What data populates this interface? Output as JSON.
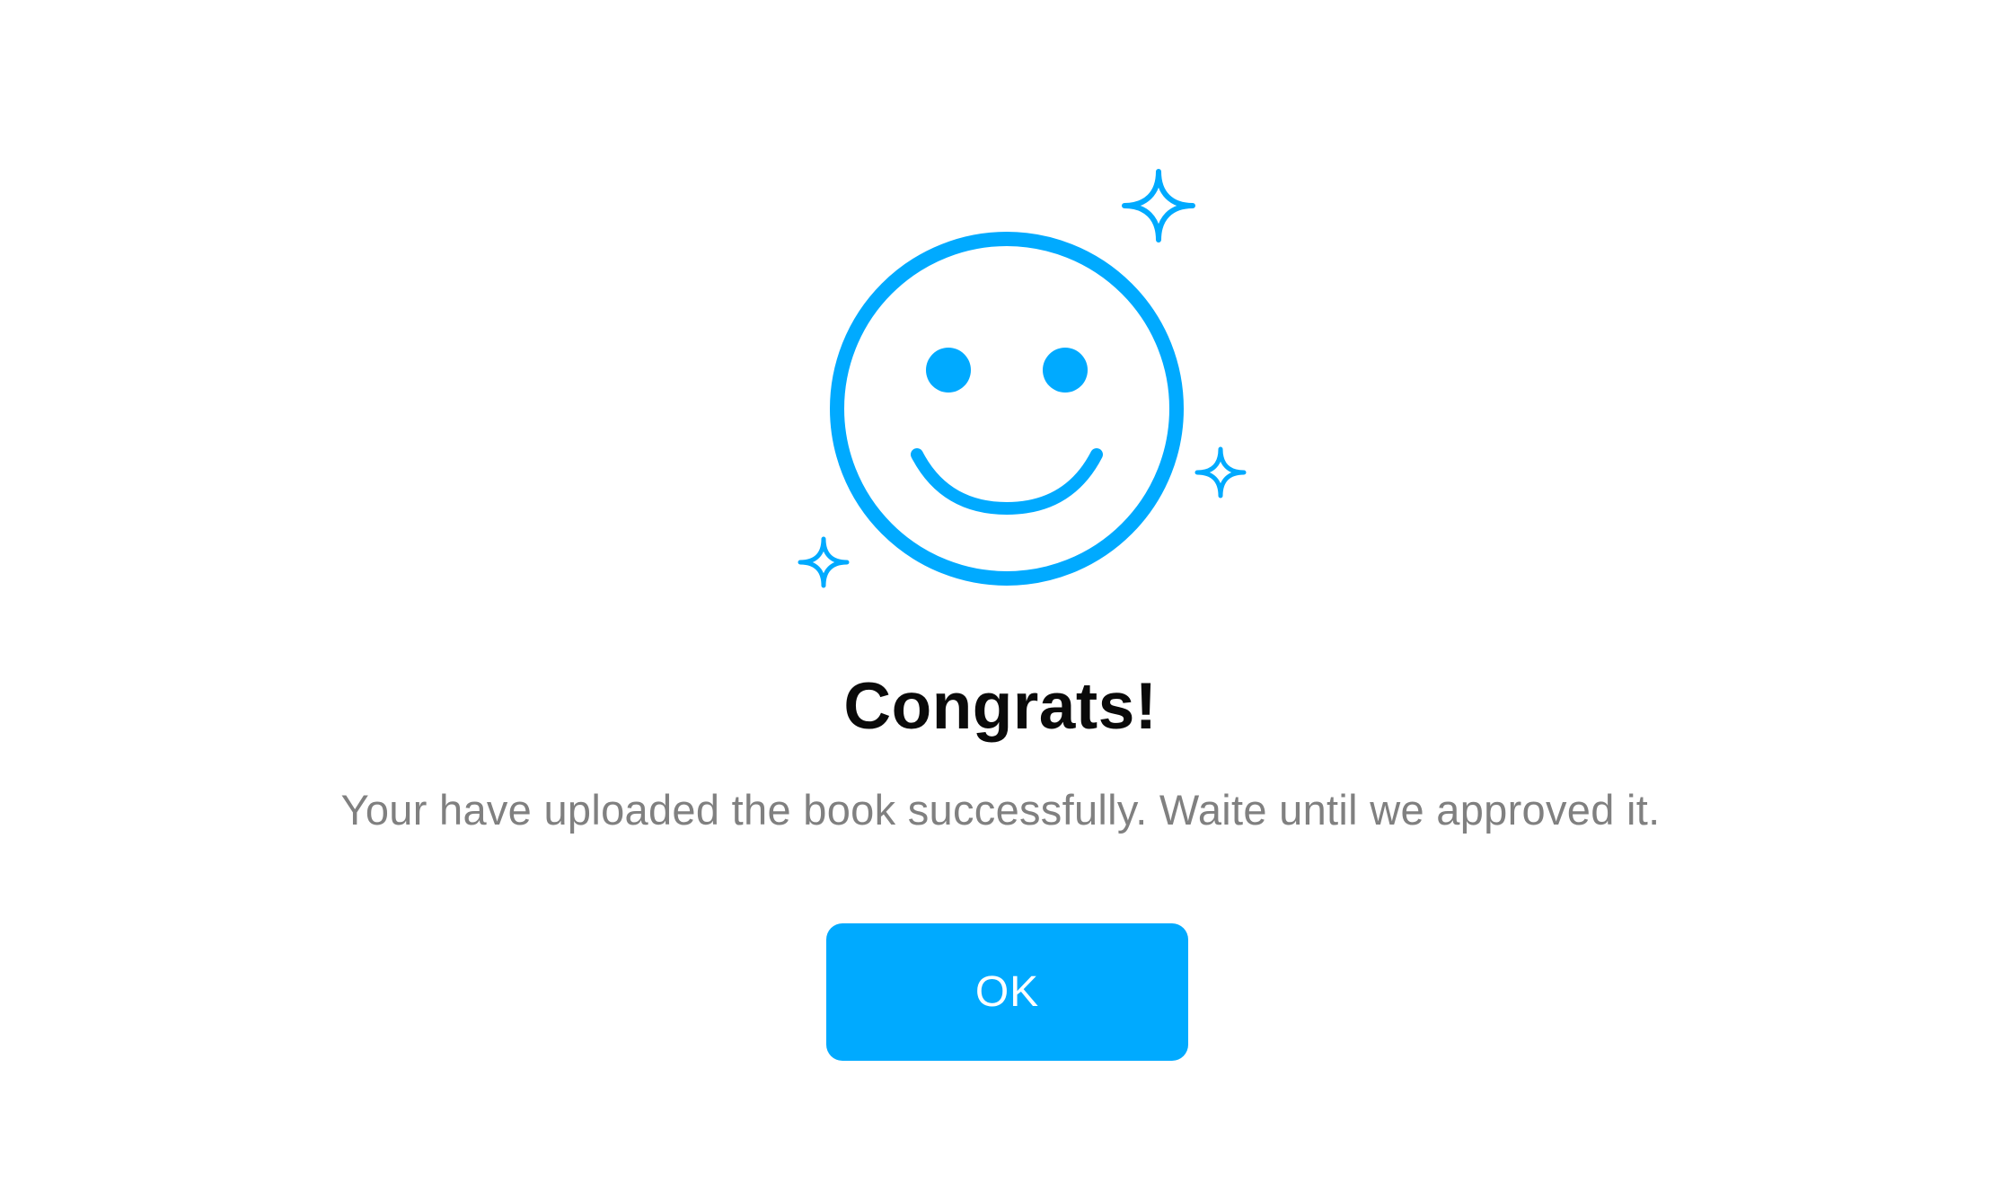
{
  "theme": {
    "accent": "#00AAFF",
    "title_color": "#0A0A0A",
    "message_color": "#808080",
    "background": "#FFFFFF"
  },
  "illustration": {
    "icon": "smiley-face-icon",
    "decorations": [
      "sparkle-icon",
      "sparkle-icon",
      "sparkle-icon"
    ]
  },
  "dialog": {
    "title": "Congrats!",
    "message": "Your have uploaded the book successfully. Waite until we approved it.",
    "ok_label": "OK"
  }
}
